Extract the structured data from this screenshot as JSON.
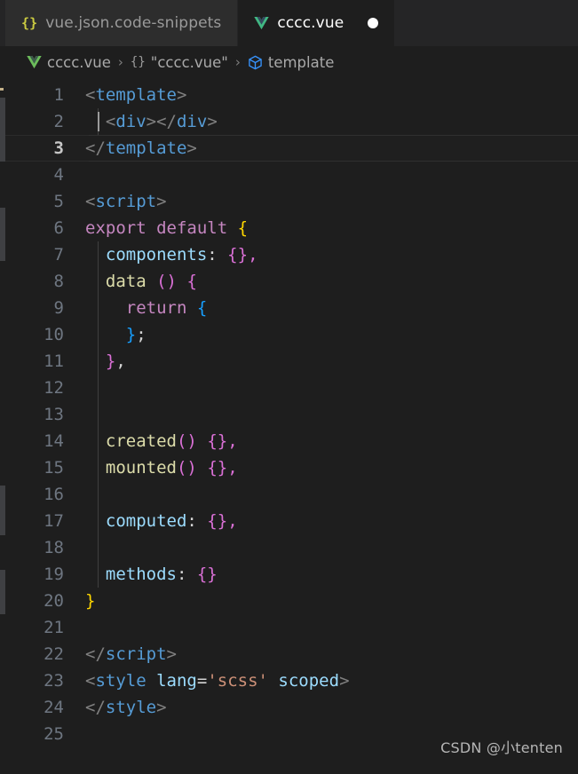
{
  "window": {
    "background": "#1e1e1e",
    "tabbar_background": "#252526"
  },
  "tabs": [
    {
      "label": "vue.json.code-snippets",
      "icon": "json-braces-icon",
      "icon_glyph": "{}",
      "active": false,
      "dirty": false,
      "icon_color": "#cbcb41"
    },
    {
      "label": "cccc.vue",
      "icon": "vue-logo-icon",
      "active": true,
      "dirty": true,
      "icon_color": "#41b883"
    }
  ],
  "breadcrumb": {
    "items": [
      {
        "label": "cccc.vue",
        "icon": "vue-logo-icon"
      },
      {
        "label": "\"cccc.vue\"",
        "icon": "json-braces-icon",
        "icon_glyph": "{}"
      },
      {
        "label": "template",
        "icon": "cube-symbol-icon"
      }
    ],
    "separator": "›"
  },
  "editor": {
    "language": "vue",
    "active_line": 3,
    "total_lines": 25,
    "line_numbers": [
      1,
      2,
      3,
      4,
      5,
      6,
      7,
      8,
      9,
      10,
      11,
      12,
      13,
      14,
      15,
      16,
      17,
      18,
      19,
      20,
      21,
      22,
      23,
      24,
      25
    ],
    "lines": [
      {
        "n": 1,
        "tokens": [
          {
            "t": "<",
            "c": "t-punct"
          },
          {
            "t": "template",
            "c": "t-tag"
          },
          {
            "t": ">",
            "c": "t-punct"
          }
        ]
      },
      {
        "n": 2,
        "tokens": [
          {
            "t": "  <",
            "c": "t-punct"
          },
          {
            "t": "div",
            "c": "t-tag"
          },
          {
            "t": "></",
            "c": "t-punct"
          },
          {
            "t": "div",
            "c": "t-tag"
          },
          {
            "t": ">",
            "c": "t-punct"
          }
        ]
      },
      {
        "n": 3,
        "tokens": [
          {
            "t": "</",
            "c": "t-punct"
          },
          {
            "t": "template",
            "c": "t-tag"
          },
          {
            "t": ">",
            "c": "t-punct"
          }
        ]
      },
      {
        "n": 4,
        "tokens": []
      },
      {
        "n": 5,
        "tokens": [
          {
            "t": "<",
            "c": "t-punct"
          },
          {
            "t": "script",
            "c": "t-tag"
          },
          {
            "t": ">",
            "c": "t-punct"
          }
        ]
      },
      {
        "n": 6,
        "tokens": [
          {
            "t": "export default ",
            "c": "t-keyword"
          },
          {
            "t": "{",
            "c": "b-yellow"
          }
        ]
      },
      {
        "n": 7,
        "tokens": [
          {
            "t": "  ",
            "c": "t-plain"
          },
          {
            "t": "components",
            "c": "t-prop"
          },
          {
            "t": ": ",
            "c": "t-colon"
          },
          {
            "t": "{}",
            "c": "b-pink"
          },
          {
            "t": ",",
            "c": "b-pink"
          }
        ]
      },
      {
        "n": 8,
        "tokens": [
          {
            "t": "  ",
            "c": "t-plain"
          },
          {
            "t": "data",
            "c": "t-func"
          },
          {
            "t": " ",
            "c": "t-plain"
          },
          {
            "t": "()",
            "c": "b-pink"
          },
          {
            "t": " ",
            "c": "t-plain"
          },
          {
            "t": "{",
            "c": "b-pink"
          }
        ]
      },
      {
        "n": 9,
        "tokens": [
          {
            "t": "    ",
            "c": "t-plain"
          },
          {
            "t": "return",
            "c": "t-keyword"
          },
          {
            "t": " ",
            "c": "t-plain"
          },
          {
            "t": "{",
            "c": "b-blue"
          }
        ]
      },
      {
        "n": 10,
        "tokens": [
          {
            "t": "    ",
            "c": "t-plain"
          },
          {
            "t": "}",
            "c": "b-blue"
          },
          {
            "t": ";",
            "c": "t-plain"
          }
        ]
      },
      {
        "n": 11,
        "tokens": [
          {
            "t": "  ",
            "c": "t-plain"
          },
          {
            "t": "}",
            "c": "b-pink"
          },
          {
            "t": ",",
            "c": "t-plain"
          }
        ]
      },
      {
        "n": 12,
        "tokens": []
      },
      {
        "n": 13,
        "tokens": []
      },
      {
        "n": 14,
        "tokens": [
          {
            "t": "  ",
            "c": "t-plain"
          },
          {
            "t": "created",
            "c": "t-func"
          },
          {
            "t": "()",
            "c": "b-pink"
          },
          {
            "t": " ",
            "c": "t-plain"
          },
          {
            "t": "{}",
            "c": "b-pink"
          },
          {
            "t": ",",
            "c": "b-pink"
          }
        ]
      },
      {
        "n": 15,
        "tokens": [
          {
            "t": "  ",
            "c": "t-plain"
          },
          {
            "t": "mounted",
            "c": "t-func"
          },
          {
            "t": "()",
            "c": "b-pink"
          },
          {
            "t": " ",
            "c": "t-plain"
          },
          {
            "t": "{}",
            "c": "b-pink"
          },
          {
            "t": ",",
            "c": "b-pink"
          }
        ]
      },
      {
        "n": 16,
        "tokens": []
      },
      {
        "n": 17,
        "tokens": [
          {
            "t": "  ",
            "c": "t-plain"
          },
          {
            "t": "computed",
            "c": "t-prop"
          },
          {
            "t": ": ",
            "c": "t-colon"
          },
          {
            "t": "{}",
            "c": "b-pink"
          },
          {
            "t": ",",
            "c": "b-pink"
          }
        ]
      },
      {
        "n": 18,
        "tokens": []
      },
      {
        "n": 19,
        "tokens": [
          {
            "t": "  ",
            "c": "t-plain"
          },
          {
            "t": "methods",
            "c": "t-prop"
          },
          {
            "t": ": ",
            "c": "t-colon"
          },
          {
            "t": "{}",
            "c": "b-pink"
          }
        ]
      },
      {
        "n": 20,
        "tokens": [
          {
            "t": "}",
            "c": "b-yellow"
          }
        ]
      },
      {
        "n": 21,
        "tokens": []
      },
      {
        "n": 22,
        "tokens": [
          {
            "t": "</",
            "c": "t-punct"
          },
          {
            "t": "script",
            "c": "t-tag"
          },
          {
            "t": ">",
            "c": "t-punct"
          }
        ]
      },
      {
        "n": 23,
        "tokens": [
          {
            "t": "<",
            "c": "t-punct"
          },
          {
            "t": "style",
            "c": "t-tag"
          },
          {
            "t": " ",
            "c": "t-plain"
          },
          {
            "t": "lang",
            "c": "t-attr"
          },
          {
            "t": "=",
            "c": "t-eq"
          },
          {
            "t": "'scss'",
            "c": "t-string"
          },
          {
            "t": " ",
            "c": "t-plain"
          },
          {
            "t": "scoped",
            "c": "t-attr"
          },
          {
            "t": ">",
            "c": "t-punct"
          }
        ]
      },
      {
        "n": 24,
        "tokens": [
          {
            "t": "</",
            "c": "t-punct"
          },
          {
            "t": "style",
            "c": "t-tag"
          },
          {
            "t": ">",
            "c": "t-punct"
          }
        ]
      },
      {
        "n": 25,
        "tokens": []
      }
    ]
  },
  "watermark": {
    "text": "CSDN @小tenten"
  }
}
